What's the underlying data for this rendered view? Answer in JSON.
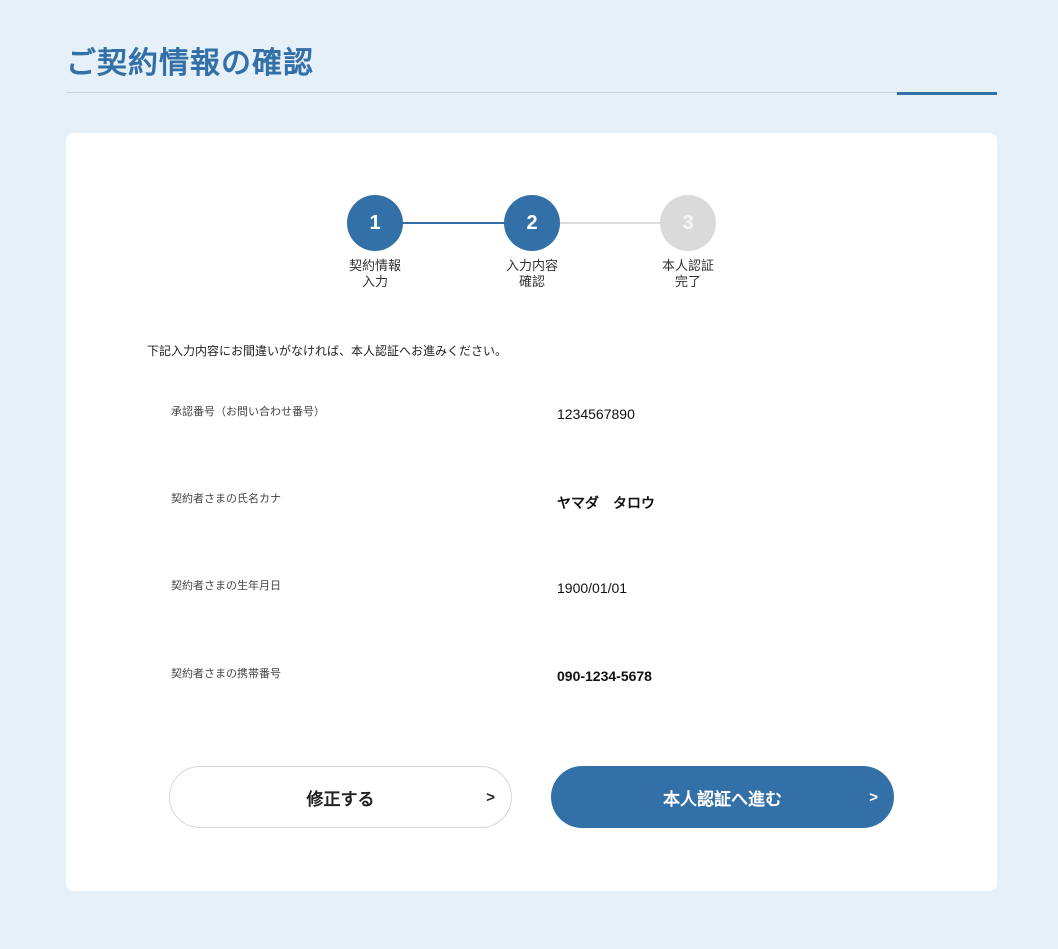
{
  "page": {
    "title": "ご契約情報の確認"
  },
  "stepper": {
    "steps": [
      {
        "number": "1",
        "label": "契約情報\n入力",
        "state": "done"
      },
      {
        "number": "2",
        "label": "入力内容\n確認",
        "state": "current"
      },
      {
        "number": "3",
        "label": "本人認証\n完了",
        "state": "upcoming"
      }
    ]
  },
  "intro": {
    "text": "下記入力内容にお間違いがなければ、本人認証へお進みください。"
  },
  "details": {
    "rows": [
      {
        "label": "承認番号（お問い合わせ番号）",
        "value": "1234567890"
      },
      {
        "label": "契約者さまの氏名カナ",
        "value": "ヤマダ　タロウ"
      },
      {
        "label": "契約者さまの生年月日",
        "value": "1900/01/01"
      },
      {
        "label": "契約者さまの携帯番号",
        "value": "090-1234-5678"
      }
    ]
  },
  "actions": {
    "edit_label": "修正する",
    "edit_arrow": ">",
    "proceed_label": "本人認証へ進む",
    "proceed_arrow": ">"
  },
  "colors": {
    "background": "#e6f0f9",
    "accent": "#3470a8",
    "card": "#ffffff",
    "inactive_step": "#dadada"
  },
  "icons": {
    "button_arrow": "chevron-right-icon"
  }
}
